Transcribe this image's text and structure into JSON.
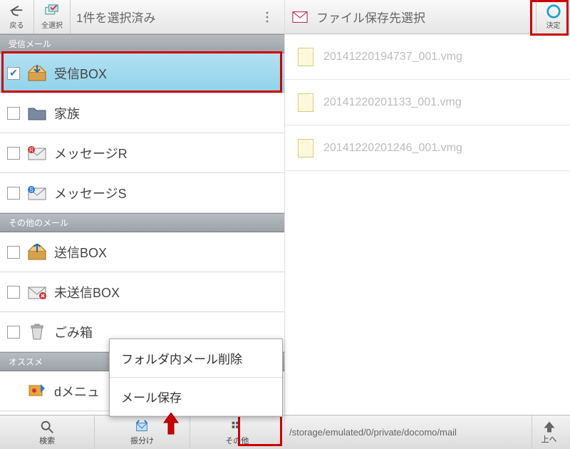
{
  "left": {
    "back_label": "戻る",
    "select_all_label": "全選択",
    "title": "1件を選択済み",
    "sections": {
      "inbox_hdr": "受信メール",
      "other_hdr": "その他のメール",
      "recommend_hdr": "オススメ"
    },
    "items": {
      "inbox": "受信BOX",
      "family": "家族",
      "msgR": "メッセージR",
      "msgS": "メッセージS",
      "outbox": "送信BOX",
      "unsent": "未送信BOX",
      "trash": "ごみ箱",
      "dmenu": "dメニュ"
    },
    "bottom": {
      "search": "検索",
      "sort": "振分け",
      "other": "その他"
    },
    "popup": {
      "delete_in_folder": "フォルダ内メール削除",
      "save_mail": "メール保存"
    }
  },
  "right": {
    "title": "ファイル保存先選択",
    "confirm_label": "決定",
    "files": {
      "f0": "20141220194737_001.vmg",
      "f1": "20141220201133_001.vmg",
      "f2": "20141220201246_001.vmg"
    },
    "path": "/storage/emulated/0/private/docomo/mail",
    "up_label": "上へ"
  }
}
